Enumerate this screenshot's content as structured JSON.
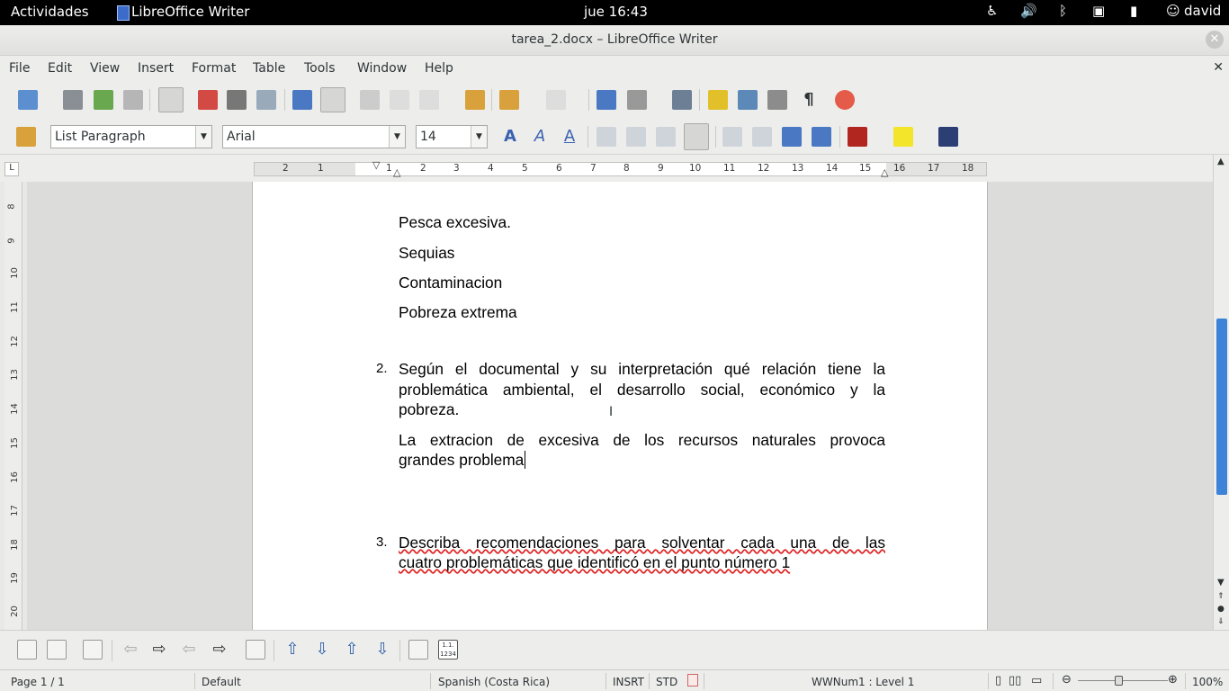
{
  "topbar": {
    "activities": "Actividades",
    "app_name": "LibreOffice Writer",
    "clock": "jue 16:43",
    "user": "david"
  },
  "window": {
    "title": "tarea_2.docx – LibreOffice Writer"
  },
  "menu": [
    "File",
    "Edit",
    "View",
    "Insert",
    "Format",
    "Table",
    "Tools",
    "Window",
    "Help"
  ],
  "formatting": {
    "style": "List Paragraph",
    "font": "Arial",
    "size": "14"
  },
  "ruler": {
    "labels": [
      "2",
      "1",
      "1",
      "2",
      "3",
      "4",
      "5",
      "6",
      "7",
      "8",
      "9",
      "10",
      "11",
      "12",
      "13",
      "14",
      "15",
      "16",
      "17",
      "18"
    ],
    "vlabels": [
      "8",
      "9",
      "10",
      "11",
      "12",
      "13",
      "14",
      "15",
      "16",
      "17",
      "18",
      "19",
      "20"
    ]
  },
  "document": {
    "items": [
      "Pesca excesiva.",
      "Sequias",
      "Contaminacion",
      "Pobreza extrema"
    ],
    "q2_num": "2.",
    "q2_lines": [
      "Según el documental y su  interpretación qué relación tiene la",
      "problemática ambiental, el  desarrollo social, económico y la",
      "pobreza."
    ],
    "a2_lines": [
      "La extracion de excesiva de los recursos naturales provoca",
      "grandes problema"
    ],
    "q3_num": "3.",
    "q3_lines": [
      "Describa recomendaciones para solventar cada una de las",
      "cuatro  problemáticas que identificó en el punto número  1"
    ]
  },
  "status": {
    "page": "Page 1 / 1",
    "page_style": "Default",
    "language": "Spanish (Costa Rica)",
    "insert_mode": "INSRT",
    "selection_mode": "STD",
    "list_level": "WWNum1 : Level 1",
    "zoom": "100%"
  },
  "colors": {
    "accent": "#3d83d7",
    "spell": "#dd2222"
  }
}
